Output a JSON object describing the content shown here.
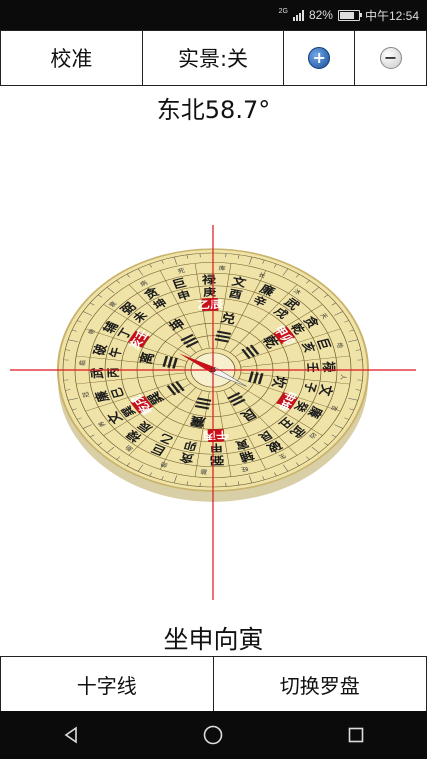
{
  "status": {
    "network": "2G",
    "battery": "82%",
    "time": "中午12:54"
  },
  "toolbar": {
    "calibrate_label": "校准",
    "live_view_label": "实景:关",
    "zoom_in_icon": "plus-circle-icon",
    "zoom_out_icon": "minus-circle-icon"
  },
  "heading": "东北58.7°",
  "compass": {
    "inner_ring": [
      "乾",
      "亥",
      "壬",
      "子",
      "癸",
      "丑",
      "艮",
      "寅",
      "甲",
      "卯",
      "乙",
      "辰",
      "巽",
      "巳",
      "丙",
      "午",
      "丁",
      "未",
      "坤",
      "申",
      "庚",
      "酉",
      "辛",
      "戌"
    ],
    "star_ring": [
      "贪",
      "巨",
      "禄",
      "文",
      "廉",
      "武",
      "破",
      "辅",
      "弼",
      "贪",
      "巨",
      "禄",
      "文",
      "廉",
      "武",
      "破",
      "辅",
      "弼",
      "贪",
      "巨",
      "禄",
      "文",
      "廉",
      "武"
    ],
    "highlight_labels": [
      "甲卯",
      "申坤",
      "午丙",
      "乾戌",
      "亥壬",
      "乙辰"
    ],
    "bagua": [
      "乾",
      "坎",
      "艮",
      "震",
      "巽",
      "离",
      "坤",
      "兑"
    ],
    "small_ring_labels": [
      "天",
      "地",
      "人",
      "吉",
      "凶",
      "生",
      "旺",
      "墓",
      "绝",
      "胎",
      "养",
      "冠",
      "临",
      "帝",
      "衰",
      "病",
      "死",
      "库",
      "长",
      "沐"
    ]
  },
  "facing": "坐申向寅",
  "bottom": {
    "crosshair_label": "十字线",
    "switch_label": "切换罗盘"
  },
  "colors": {
    "compass_face": "#efe3a8",
    "compass_edge": "#c9b26a",
    "highlight_red": "#c8101a",
    "crosshair": "#e0151f"
  }
}
